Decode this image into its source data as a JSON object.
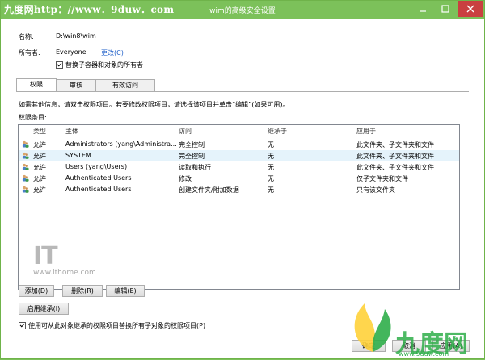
{
  "watermark_top": "九度网http：//www．9duw．com",
  "window": {
    "title": "wim的高级安全设置"
  },
  "info": {
    "name_label": "名称:",
    "name_value": "D:\\win8\\wim",
    "owner_label": "所有者:",
    "owner_value": "Everyone",
    "change_link": "更改(C)",
    "replace_owner": "替换子容器和对象的所有者",
    "replace_owner_checked": true
  },
  "tabs": [
    {
      "label": "权限",
      "active": true
    },
    {
      "label": "审核",
      "active": false
    },
    {
      "label": "有效访问",
      "active": false
    }
  ],
  "hint": "如需其他信息，请双击权限项目。若要修改权限项目，请选择该项目并单击“编辑”(如果可用)。",
  "entries_label": "权限条目:",
  "table": {
    "headers": [
      "类型",
      "主体",
      "访问",
      "继承于",
      "应用于"
    ],
    "rows": [
      {
        "type": "允许",
        "principal": "Administrators (yang\\Administra...",
        "access": "完全控制",
        "inherited": "无",
        "applies": "此文件夹、子文件夹和文件",
        "selected": false
      },
      {
        "type": "允许",
        "principal": "SYSTEM",
        "access": "完全控制",
        "inherited": "无",
        "applies": "此文件夹、子文件夹和文件",
        "selected": true
      },
      {
        "type": "允许",
        "principal": "Users (yang\\Users)",
        "access": "读取和执行",
        "inherited": "无",
        "applies": "此文件夹、子文件夹和文件",
        "selected": false
      },
      {
        "type": "允许",
        "principal": "Authenticated Users",
        "access": "修改",
        "inherited": "无",
        "applies": "仅子文件夹和文件",
        "selected": false
      },
      {
        "type": "允许",
        "principal": "Authenticated Users",
        "access": "创建文件夹/附加数据",
        "inherited": "无",
        "applies": "只有该文件夹",
        "selected": false
      }
    ]
  },
  "it_watermark": {
    "logo": "IT",
    "url": "www.ithome.com"
  },
  "buttons": {
    "add": "添加(D)",
    "remove": "删除(R)",
    "edit": "编辑(E)",
    "enable_inheritance": "启用继承(I)",
    "ok": "确定",
    "cancel": "取消",
    "apply": "应用(A)"
  },
  "replace_child": "使用可从此对象继承的权限项目替换所有子对象的权限项目(P)",
  "replace_child_checked": true,
  "brand": {
    "name": "九度网",
    "url": "www.9duw.com"
  }
}
